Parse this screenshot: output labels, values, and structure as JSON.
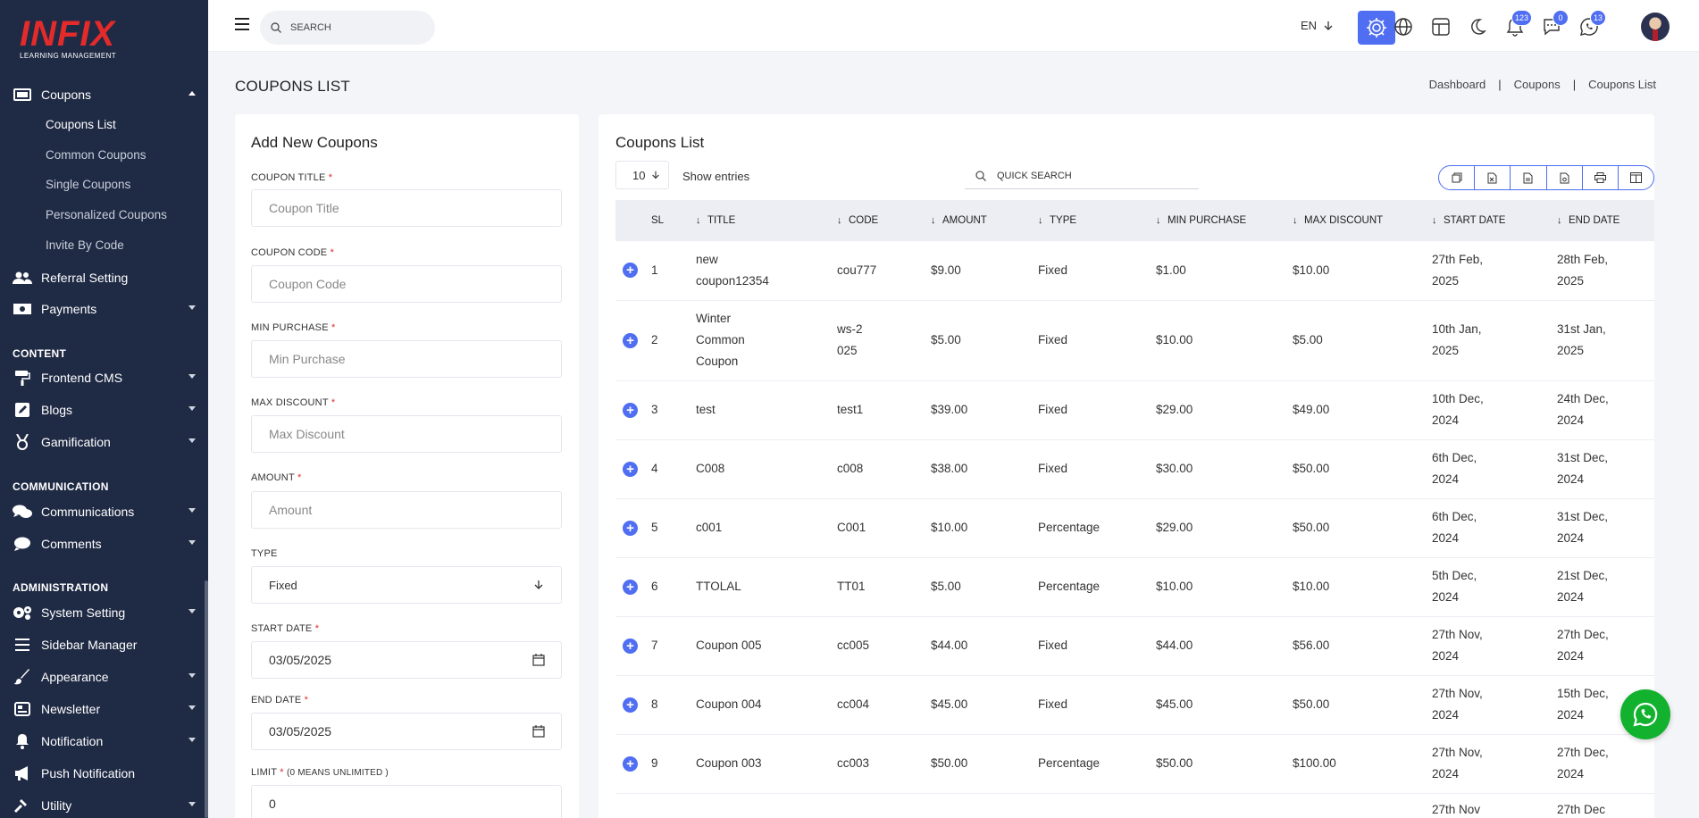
{
  "logo": {
    "main": "INFIX",
    "sub": "LEARNING MANAGEMENT"
  },
  "sidebar": {
    "coupons": "Coupons",
    "coupon_sub": [
      "Coupons List",
      "Common Coupons",
      "Single Coupons",
      "Personalized Coupons",
      "Invite By Code"
    ],
    "referral": "Referral Setting",
    "payments": "Payments",
    "content_title": "CONTENT",
    "frontend_cms": "Frontend CMS",
    "blogs": "Blogs",
    "gamification": "Gamification",
    "communication_title": "COMMUNICATION",
    "communications": "Communications",
    "comments": "Comments",
    "administration_title": "ADMINISTRATION",
    "system_setting": "System Setting",
    "sidebar_manager": "Sidebar Manager",
    "appearance": "Appearance",
    "newsletter": "Newsletter",
    "notification": "Notification",
    "push_notification": "Push Notification",
    "utility": "Utility"
  },
  "topbar": {
    "search_placeholder": "SEARCH",
    "lang": "EN",
    "notif_badge": "123",
    "message_badge": "0",
    "whatsapp_badge": "13"
  },
  "page": {
    "title": "COUPONS LIST",
    "breadcrumb": [
      "Dashboard",
      "Coupons",
      "Coupons List"
    ]
  },
  "form": {
    "title": "Add New Coupons",
    "coupon_title_label": "COUPON TITLE",
    "coupon_title_placeholder": "Coupon Title",
    "coupon_code_label": "COUPON CODE",
    "coupon_code_placeholder": "Coupon Code",
    "min_purchase_label": "MIN PURCHASE",
    "min_purchase_placeholder": "Min Purchase",
    "max_discount_label": "MAX DISCOUNT",
    "max_discount_placeholder": "Max Discount",
    "amount_label": "AMOUNT",
    "amount_placeholder": "Amount",
    "type_label": "TYPE",
    "type_value": "Fixed",
    "start_date_label": "START DATE",
    "start_date_value": "03/05/2025",
    "end_date_label": "END DATE",
    "end_date_value": "03/05/2025",
    "limit_label": "LIMIT",
    "limit_hint": "(0 MEANS UNLIMITED )",
    "limit_value": "0",
    "required_mark": "*"
  },
  "list": {
    "title": "Coupons List",
    "entries_value": "10",
    "entries_label": "Show entries",
    "quick_search": "QUICK SEARCH",
    "columns": [
      "SL",
      "TITLE",
      "CODE",
      "AMOUNT",
      "TYPE",
      "MIN PURCHASE",
      "MAX DISCOUNT",
      "START DATE",
      "END DATE"
    ],
    "rows": [
      {
        "sl": "1",
        "title": "new coupon12354",
        "code": "cou777",
        "amount": "$9.00",
        "type": "Fixed",
        "min": "$1.00",
        "max": "$10.00",
        "start": "27th Feb, 2025",
        "end": "28th Feb, 2025"
      },
      {
        "sl": "2",
        "title": "Winter Common Coupon",
        "code": "ws-2025",
        "amount": "$5.00",
        "type": "Fixed",
        "min": "$10.00",
        "max": "$5.00",
        "start": "10th Jan, 2025",
        "end": "31st Jan, 2025"
      },
      {
        "sl": "3",
        "title": "test",
        "code": "test1",
        "amount": "$39.00",
        "type": "Fixed",
        "min": "$29.00",
        "max": "$49.00",
        "start": "10th Dec, 2024",
        "end": "24th Dec, 2024"
      },
      {
        "sl": "4",
        "title": "C008",
        "code": "c008",
        "amount": "$38.00",
        "type": "Fixed",
        "min": "$30.00",
        "max": "$50.00",
        "start": "6th Dec, 2024",
        "end": "31st Dec, 2024"
      },
      {
        "sl": "5",
        "title": "c001",
        "code": "C001",
        "amount": "$10.00",
        "type": "Percentage",
        "min": "$29.00",
        "max": "$50.00",
        "start": "6th Dec, 2024",
        "end": "31st Dec, 2024"
      },
      {
        "sl": "6",
        "title": "TTOLAL",
        "code": "TT01",
        "amount": "$5.00",
        "type": "Percentage",
        "min": "$10.00",
        "max": "$10.00",
        "start": "5th Dec, 2024",
        "end": "21st Dec, 2024"
      },
      {
        "sl": "7",
        "title": "Coupon 005",
        "code": "cc005",
        "amount": "$44.00",
        "type": "Fixed",
        "min": "$44.00",
        "max": "$56.00",
        "start": "27th Nov, 2024",
        "end": "27th Dec, 2024"
      },
      {
        "sl": "8",
        "title": "Coupon 004",
        "code": "cc004",
        "amount": "$45.00",
        "type": "Fixed",
        "min": "$45.00",
        "max": "$50.00",
        "start": "27th Nov, 2024",
        "end": "15th Dec, 2024"
      },
      {
        "sl": "9",
        "title": "Coupon 003",
        "code": "cc003",
        "amount": "$50.00",
        "type": "Percentage",
        "min": "$50.00",
        "max": "$100.00",
        "start": "27th Nov, 2024",
        "end": "27th Dec, 2024"
      },
      {
        "sl": "",
        "title": "",
        "code": "",
        "amount": "",
        "type": "",
        "min": "",
        "max": "",
        "start": "27th Nov",
        "end": "27th Dec"
      }
    ]
  },
  "colors": {
    "sidebar": "#1f2a44",
    "accent": "#4f6ef2",
    "brand_red": "#e32b2b",
    "whatsapp": "#12b22e"
  }
}
